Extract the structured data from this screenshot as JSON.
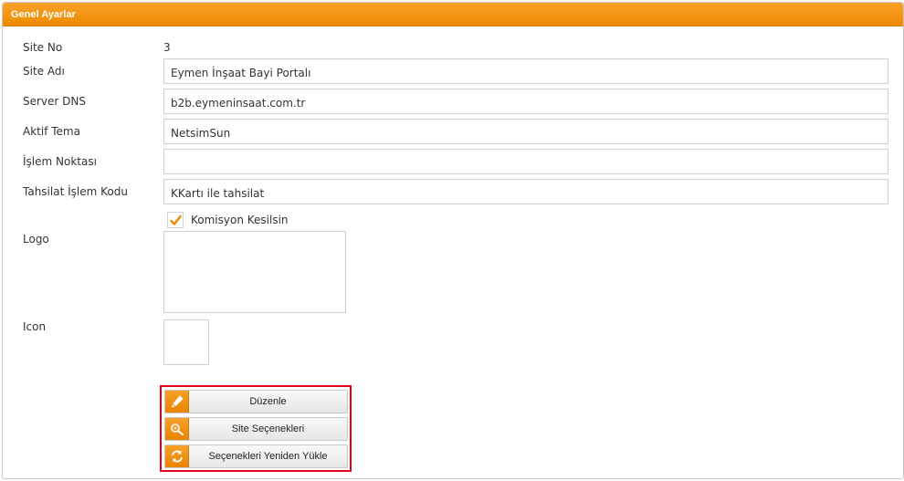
{
  "panel": {
    "title": "Genel Ayarlar"
  },
  "form": {
    "site_no": {
      "label": "Site No",
      "value": "3"
    },
    "site_adi": {
      "label": "Site Adı",
      "value": "Eymen İnşaat Bayi Portalı"
    },
    "server_dns": {
      "label": "Server DNS",
      "value": "b2b.eymeninsaat.com.tr"
    },
    "aktif_tema": {
      "label": "Aktif Tema",
      "value": "NetsimSun"
    },
    "islem_noktasi": {
      "label": "İşlem Noktası",
      "value": ""
    },
    "tahsilat_islem_kodu": {
      "label": "Tahsilat İşlem Kodu",
      "value": "KKartı ile tahsilat"
    },
    "komisyon": {
      "label": "Komisyon Kesilsin",
      "checked": true
    },
    "logo": {
      "label": "Logo"
    },
    "icon": {
      "label": "Icon"
    }
  },
  "buttons": {
    "duzenle": {
      "label": "Düzenle",
      "icon": "pencil-icon"
    },
    "site_secenekleri": {
      "label": "Site Seçenekleri",
      "icon": "settings-search-icon"
    },
    "yeniden_yukle": {
      "label": "Seçenekleri Yeniden Yükle",
      "icon": "refresh-icon"
    }
  },
  "colors": {
    "accent": "#ef8a00",
    "highlight_border": "#e0001a"
  }
}
